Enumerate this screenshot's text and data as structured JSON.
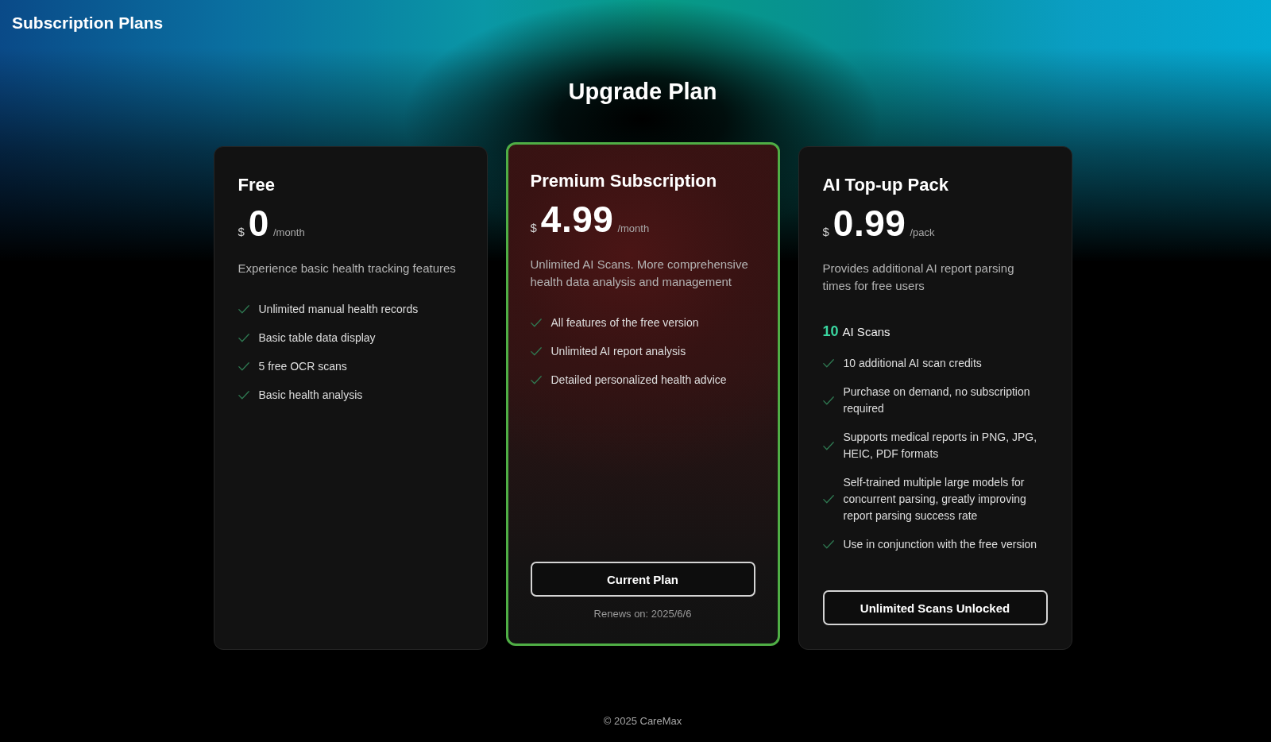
{
  "header": {
    "title": "Subscription Plans"
  },
  "heading": "Upgrade Plan",
  "plans": [
    {
      "name": "Free",
      "currency": "$",
      "price": "0",
      "period": "/month",
      "description": "Experience basic health tracking features",
      "selected": false,
      "features": [
        "Unlimited manual health records",
        "Basic table data display",
        "5 free OCR scans",
        "Basic health analysis"
      ]
    },
    {
      "name": "Premium Subscription",
      "currency": "$",
      "price": "4.99",
      "period": "/month",
      "description": "Unlimited AI Scans. More comprehensive health data analysis and management",
      "selected": true,
      "features": [
        "All features of the free version",
        "Unlimited AI report analysis",
        "Detailed personalized health advice"
      ],
      "button": "Current Plan",
      "note": "Renews on: 2025/6/6"
    },
    {
      "name": "AI Top-up Pack",
      "currency": "$",
      "price": "0.99",
      "period": "/pack",
      "description": "Provides additional AI report parsing times for free users",
      "selected": false,
      "credits": {
        "count": "10",
        "label": "AI Scans"
      },
      "features": [
        "10 additional AI scan credits",
        "Purchase on demand, no subscription required",
        "Supports medical reports in PNG, JPG, HEIC, PDF formats",
        "Self-trained multiple large models for concurrent parsing, greatly improving report parsing success rate",
        "Use in conjunction with the free version"
      ],
      "button": "Unlimited Scans Unlocked"
    }
  ],
  "footer": {
    "copyright": "© 2025 CareMax"
  }
}
